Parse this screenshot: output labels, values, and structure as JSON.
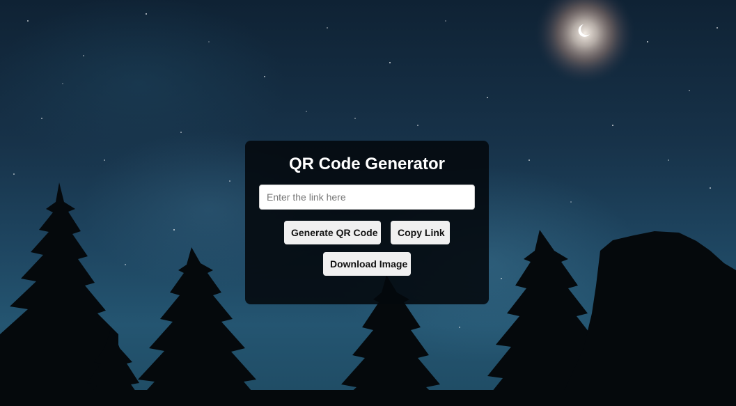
{
  "card": {
    "title": "QR Code Generator",
    "input": {
      "value": "",
      "placeholder": "Enter the link here"
    },
    "buttons": {
      "generate_label": "Generate QR Code",
      "copy_label": "Copy Link",
      "download_label": "Download Image"
    }
  },
  "background": {
    "scene": "night-sky-pine-forest",
    "colors": {
      "sky_top": "#0f2234",
      "sky_bottom": "#245571",
      "silhouette": "#05090c",
      "moon": "#ffffff"
    }
  },
  "colors": {
    "card_bg": "#03080c",
    "title_text": "#ffffff",
    "button_bg": "#f0f0f0",
    "button_text": "#111111"
  }
}
